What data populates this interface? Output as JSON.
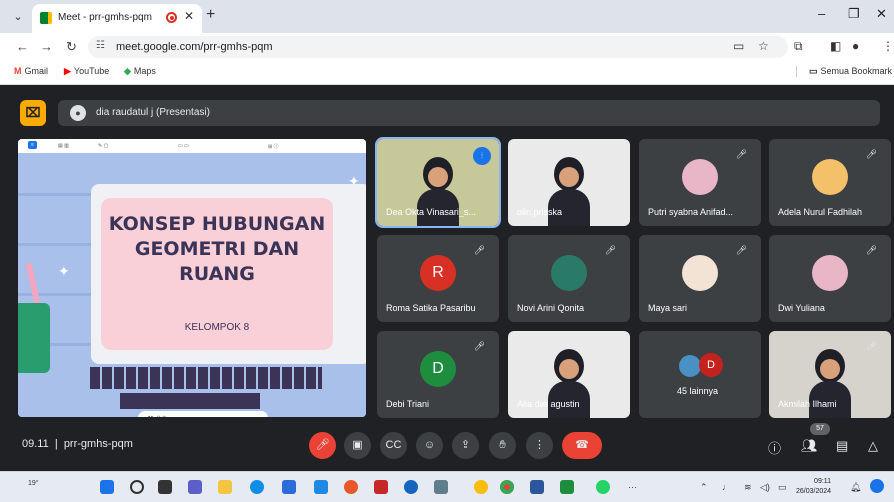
{
  "browser": {
    "tab_title": "Meet - prr-gmhs-pqm",
    "url": "meet.google.com/prr-gmhs-pqm",
    "bookmarks": [
      "Gmail",
      "YouTube",
      "Maps"
    ],
    "bookmarks_folder": "Semua Bookmark"
  },
  "meet": {
    "presenter_banner": "dia raudatul j (Presentasi)",
    "slide": {
      "title": "KONSEP HUBUNGAN GEOMETRI DAN RUANG",
      "subtitle": "KELOMPOK 8"
    },
    "participants": [
      {
        "name": "Dea Okta Vinasari_s...",
        "type": "video",
        "speaking": true
      },
      {
        "name": "olin prisska",
        "type": "video"
      },
      {
        "name": "Putri syabna Anifad...",
        "type": "photo"
      },
      {
        "name": "Adela Nurul Fadhilah",
        "type": "photo"
      },
      {
        "name": "Roma Satika Pasaribu",
        "type": "initial",
        "initial": "R",
        "color": "#d93025"
      },
      {
        "name": "Novi Arini Qonita",
        "type": "photo"
      },
      {
        "name": "Maya sari",
        "type": "photo"
      },
      {
        "name": "Dwi Yuliana",
        "type": "photo"
      },
      {
        "name": "Debi Triani",
        "type": "initial",
        "initial": "D",
        "color": "#1e8e3e"
      },
      {
        "name": "Alia dwi agustin",
        "type": "video"
      },
      {
        "name": "45 lainnya",
        "type": "more",
        "initial": "D"
      },
      {
        "name": "Akmilah Ilhami",
        "type": "video"
      }
    ],
    "bottom_bar": {
      "time": "09.11",
      "meeting_code": "prr-gmhs-pqm",
      "people_count": "57"
    }
  },
  "taskbar": {
    "weather": "19°",
    "time": "09:11",
    "date": "26/03/2024"
  }
}
